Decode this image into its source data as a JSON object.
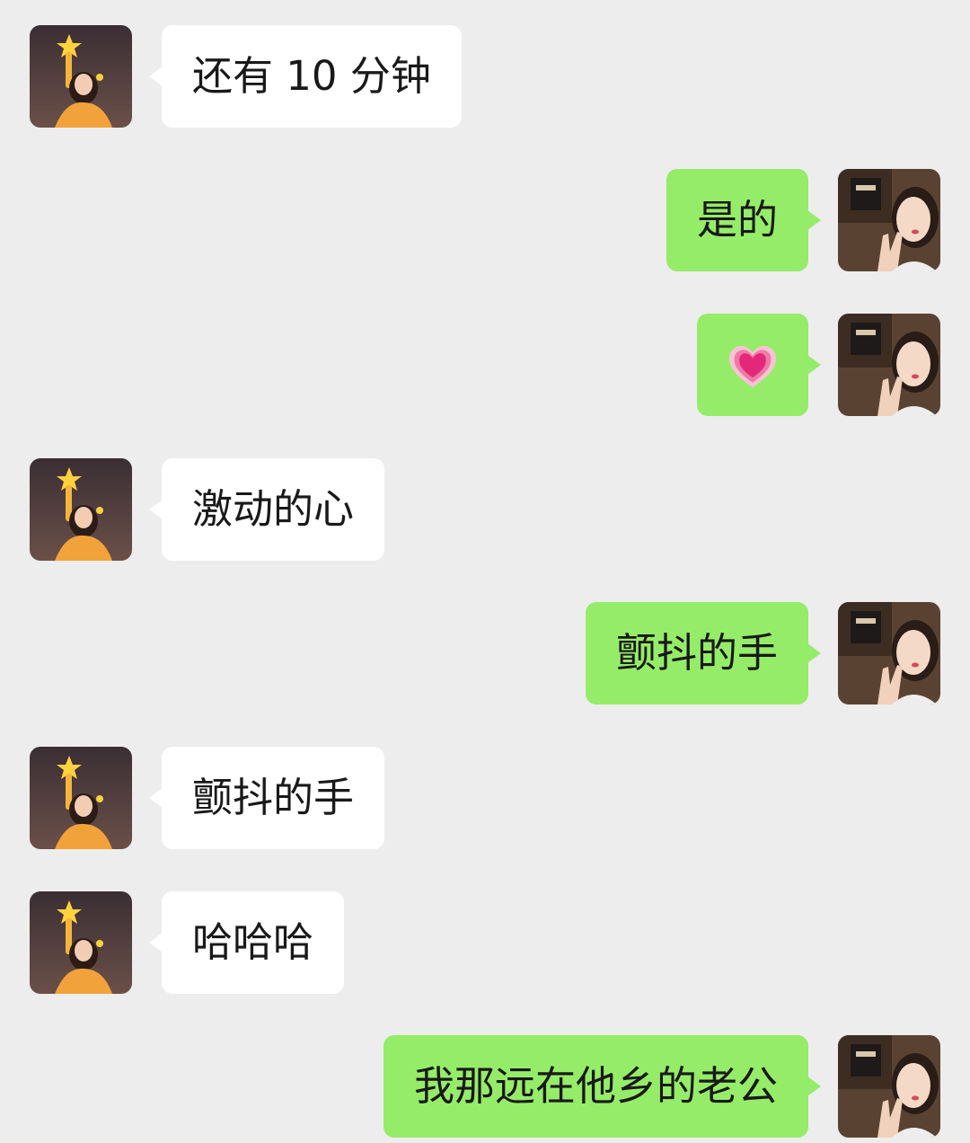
{
  "messages": [
    {
      "side": "in",
      "text": "还有 10 分钟",
      "avatar": "girl-with-star-avatar"
    },
    {
      "side": "out",
      "text": "是的",
      "avatar": "selfie-peace-sign-avatar"
    },
    {
      "side": "out",
      "text": "💗",
      "avatar": "selfie-peace-sign-avatar",
      "emoji": "growing-heart"
    },
    {
      "side": "in",
      "text": "激动的心",
      "avatar": "girl-with-star-avatar"
    },
    {
      "side": "out",
      "text": "颤抖的手",
      "avatar": "selfie-peace-sign-avatar"
    },
    {
      "side": "in",
      "text": "颤抖的手",
      "avatar": "girl-with-star-avatar"
    },
    {
      "side": "in",
      "text": "哈哈哈",
      "avatar": "girl-with-star-avatar"
    },
    {
      "side": "out",
      "text": "我那远在他乡的老公",
      "avatar": "selfie-peace-sign-avatar"
    }
  ],
  "colors": {
    "background": "#ededed",
    "incoming_bubble": "#ffffff",
    "outgoing_bubble": "#95ec69",
    "text": "#191919"
  }
}
